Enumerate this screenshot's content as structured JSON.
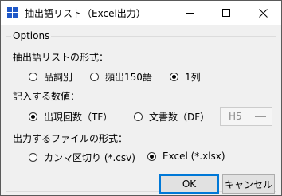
{
  "window": {
    "title": "抽出語リスト（Excel出力）",
    "icon": "app-grid-icon",
    "controls": {
      "minimize": "minimize-icon",
      "maximize": "maximize-icon",
      "close": "close-icon"
    }
  },
  "options": {
    "legend": "Options",
    "format_section": {
      "label": "抽出語リストの形式：",
      "choices": [
        {
          "label": "品詞別",
          "checked": false
        },
        {
          "label": "頻出150語",
          "checked": false
        },
        {
          "label": "1列",
          "checked": true
        }
      ]
    },
    "value_section": {
      "label": "記入する数値：",
      "choices": [
        {
          "label": "出現回数（TF）",
          "checked": true
        },
        {
          "label": "文書数（DF）",
          "checked": false
        }
      ],
      "unit_select": {
        "value": "H5",
        "enabled": false
      }
    },
    "file_section": {
      "label": "出力するファイルの形式：",
      "choices": [
        {
          "label": "カンマ区切り (*.csv)",
          "checked": false
        },
        {
          "label": "Excel (*.xlsx)",
          "checked": true
        }
      ]
    }
  },
  "buttons": {
    "ok": "OK",
    "cancel": "キャンセル"
  },
  "colors": {
    "accent": "#0078d7",
    "icon_blue": "#1f58c8"
  }
}
